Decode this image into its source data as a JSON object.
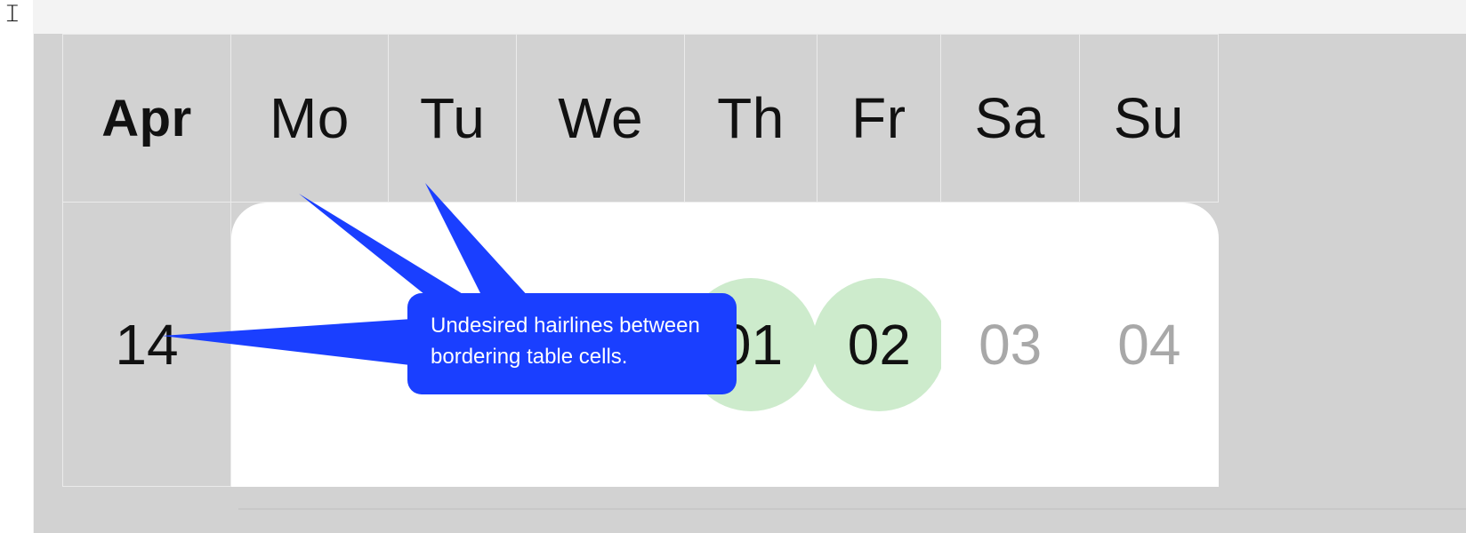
{
  "calendar": {
    "month_label": "Apr",
    "week_number": "14",
    "day_headers": [
      "Mo",
      "Tu",
      "We",
      "Th",
      "Fr",
      "Sa",
      "Su"
    ],
    "days": [
      {
        "label": "",
        "highlight": false,
        "muted": false
      },
      {
        "label": "",
        "highlight": false,
        "muted": false
      },
      {
        "label": "",
        "highlight": false,
        "muted": false
      },
      {
        "label": "01",
        "highlight": true,
        "muted": false
      },
      {
        "label": "02",
        "highlight": true,
        "muted": false
      },
      {
        "label": "03",
        "highlight": false,
        "muted": true
      },
      {
        "label": "04",
        "highlight": false,
        "muted": true
      }
    ]
  },
  "annotation": {
    "text": "Undesired hairlines between bordering table cells.",
    "color": "#1a3fff"
  },
  "colors": {
    "header_bg": "#d2d2d2",
    "body_bg": "#ffffff",
    "highlight_circle": "#cdebcc",
    "muted_text": "#a8a8a8",
    "hairline": "rgba(255,255,255,0.55)"
  }
}
